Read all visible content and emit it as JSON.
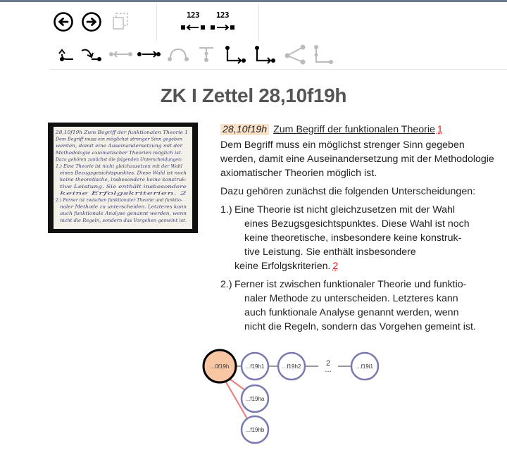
{
  "toolbar": {
    "back_icon": "arrow-left-circle-icon",
    "forward_icon": "arrow-right-circle-icon",
    "copy_icon": "copy-icon",
    "count_left": "123",
    "count_right": "123",
    "nav_icons": [
      "link-back-icon",
      "link-forward-icon",
      "prev-sibling-icon",
      "next-sibling-icon",
      "arc-icon",
      "branch-up-icon",
      "branch-down-icon",
      "branch-down-2-icon",
      "share-icon",
      "tree-icon"
    ]
  },
  "page_title": "ZK I Zettel 28,10f19h",
  "note": {
    "id": "28,10f19h",
    "heading": "Zum Begriff der funktionalen Theorie",
    "heading_footnote": "1",
    "para1": "Dem Begriff muss ein möglichst strenger Sinn gegeben werden, damit eine Auseinandersetzung mit der Methodologie axiomatischer Theorien möglich ist.",
    "para2": "Dazu gehören zunächst die folgenden Unterscheidungen:",
    "item1": {
      "num": "1.)",
      "lines": [
        "Eine Theorie ist nicht gleichzusetzen mit der Wahl",
        "eines Bezugsgesichtspunktes. Diese Wahl ist noch",
        "keine theoretische, insbesondere keine konstruk-",
        "tive Leistung. Sie enthält insbesondere",
        "keine Erfolgskriterien."
      ],
      "footnote": "2"
    },
    "item2": {
      "num": "2.)",
      "lines": [
        "Ferner ist zwischen funktionaler Theorie und funktio-",
        "naler Methode zu unterscheiden. Letzteres kann",
        "auch funktionale Analyse genannt werden, wenn",
        "nicht die Regeln, sondern das Vorgehen gemeint ist."
      ]
    }
  },
  "scan": {
    "lines": [
      "28,10f19h  Zum Begriff der funktionalen Theorie 1",
      "Dem Begriff muss ein möglichst strenger Sinn gegeben",
      "werden, damit eine Auseinandersetzung mit der",
      "Methodologie axiomatischer Theorien möglich ist.",
      "Dazu gehören zunächst die folgenden Unterscheidungen:",
      "1.) Eine Theorie ist nicht gleichzusetzen mit der Wahl",
      "eines Bezugsgesichtspunktes. Diese Wahl ist noch",
      "keine theoretische, insbesondere keine konstruk-",
      "tive Leistung. Sie enthält insbesondere",
      "keine Erfolgskriterien. 2",
      "2.) Ferner ist zwischen funktionaler Theorie und funktio-",
      "naler Methode zu unterscheiden. Letzteres kann",
      "auch funktionale Analyse genannt werden, wenn",
      "nicht die Regeln, sondern das Vorgehen gemeint ist."
    ]
  },
  "graph": {
    "current": "...0f19h",
    "siblings": [
      "...f19h1",
      "...f19h2",
      "...f19i1"
    ],
    "gap_count": "2",
    "gap_dots": "...",
    "children": [
      "...f19ha",
      "...f19hb"
    ],
    "colors": {
      "current_fill": "#f9c6a4",
      "node_stroke": "#7a7ab0",
      "child_edge": "#f08080",
      "edge": "#999999"
    }
  }
}
